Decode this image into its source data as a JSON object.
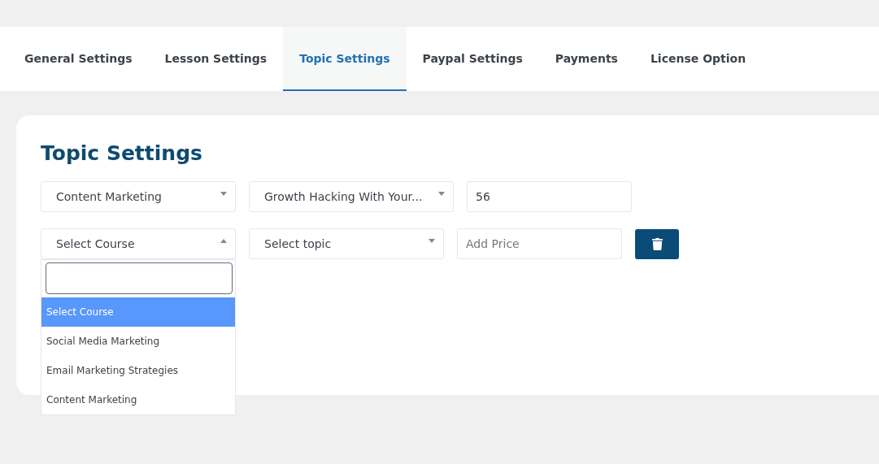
{
  "tabs": [
    {
      "label": "General Settings",
      "selected": false
    },
    {
      "label": "Lesson Settings",
      "selected": false
    },
    {
      "label": "Topic Settings",
      "selected": true
    },
    {
      "label": "Paypal Settings",
      "selected": false
    },
    {
      "label": "Payments",
      "selected": false
    },
    {
      "label": "License Option",
      "selected": false
    }
  ],
  "title": "Topic Settings",
  "rows": [
    {
      "course": {
        "value": "Content Marketing",
        "open": false
      },
      "topic": {
        "value": "Growth Hacking With Your..."
      },
      "price": {
        "value": "56"
      },
      "deletable": false
    },
    {
      "course": {
        "value": "Select Course",
        "open": true
      },
      "topic": {
        "value": "Select topic"
      },
      "price": {
        "placeholder": "Add Price"
      },
      "deletable": true
    }
  ],
  "dropdown": {
    "options": [
      {
        "label": "Select Course",
        "selected": true
      },
      {
        "label": "Social Media Marketing",
        "selected": false
      },
      {
        "label": "Email Marketing Strategies",
        "selected": false
      },
      {
        "label": "Content Marketing",
        "selected": false
      }
    ]
  }
}
